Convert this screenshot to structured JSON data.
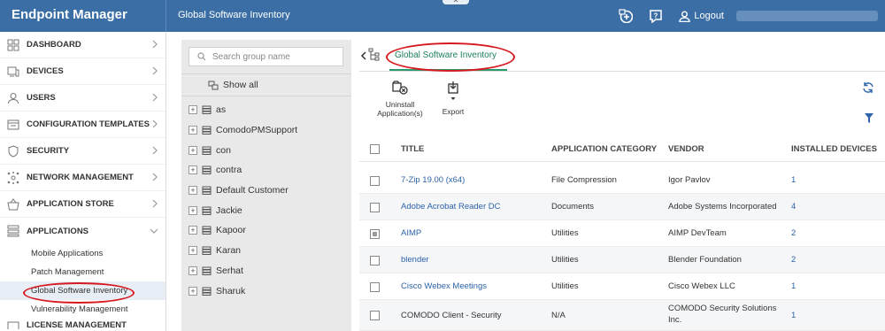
{
  "app": {
    "title": "Endpoint Manager",
    "breadcrumb": "Global Software Inventory",
    "logout": "Logout",
    "top_pill": "✕"
  },
  "sidebar": {
    "items": [
      {
        "label": "DASHBOARD",
        "icon": "dashboard-icon"
      },
      {
        "label": "DEVICES",
        "icon": "devices-icon"
      },
      {
        "label": "USERS",
        "icon": "users-icon"
      },
      {
        "label": "CONFIGURATION TEMPLATES",
        "icon": "templates-icon"
      },
      {
        "label": "SECURITY",
        "icon": "shield-icon"
      },
      {
        "label": "NETWORK MANAGEMENT",
        "icon": "network-icon"
      },
      {
        "label": "APPLICATION STORE",
        "icon": "store-icon"
      },
      {
        "label": "APPLICATIONS",
        "icon": "applications-icon"
      }
    ],
    "sub_items": [
      "Mobile Applications",
      "Patch Management",
      "Global Software Inventory",
      "Vulnerability Management"
    ],
    "partial_item": "LICENSE MANAGEMENT"
  },
  "groups": {
    "search_placeholder": "Search group name",
    "show_all": "Show all",
    "items": [
      "as",
      "ComodoPMSupport",
      "con",
      "contra",
      "Default Customer",
      "Jackie",
      "Kapoor",
      "Karan",
      "Serhat",
      "Sharuk"
    ]
  },
  "content": {
    "tab": "Global Software Inventory",
    "toolbar": {
      "uninstall": "Uninstall Application(s)",
      "export": "Export"
    },
    "columns": [
      "TITLE",
      "APPLICATION CATEGORY",
      "VENDOR",
      "INSTALLED DEVICES"
    ],
    "rows": [
      {
        "title": "7-Zip 19.00 (x64)",
        "category": "File Compression",
        "vendor": "Igor Pavlov",
        "installed": "1"
      },
      {
        "title": "Adobe Acrobat Reader DC",
        "category": "Documents",
        "vendor": "Adobe Systems Incorporated",
        "installed": "4"
      },
      {
        "title": "AIMP",
        "category": "Utilities",
        "vendor": "AIMP DevTeam",
        "installed": "2"
      },
      {
        "title": "blender",
        "category": "Utilities",
        "vendor": "Blender Foundation",
        "installed": "2"
      },
      {
        "title": "Cisco Webex Meetings",
        "category": "Utilities",
        "vendor": "Cisco Webex LLC",
        "installed": "1"
      },
      {
        "title": "COMODO Client - Security",
        "category": "N/A",
        "vendor": "COMODO Security Solutions Inc.",
        "installed": "1"
      }
    ]
  },
  "colors": {
    "topbar": "#3a6ea5",
    "link": "#2d63a8",
    "tab_accent": "#2a9a6c",
    "highlight": "#d71920"
  }
}
